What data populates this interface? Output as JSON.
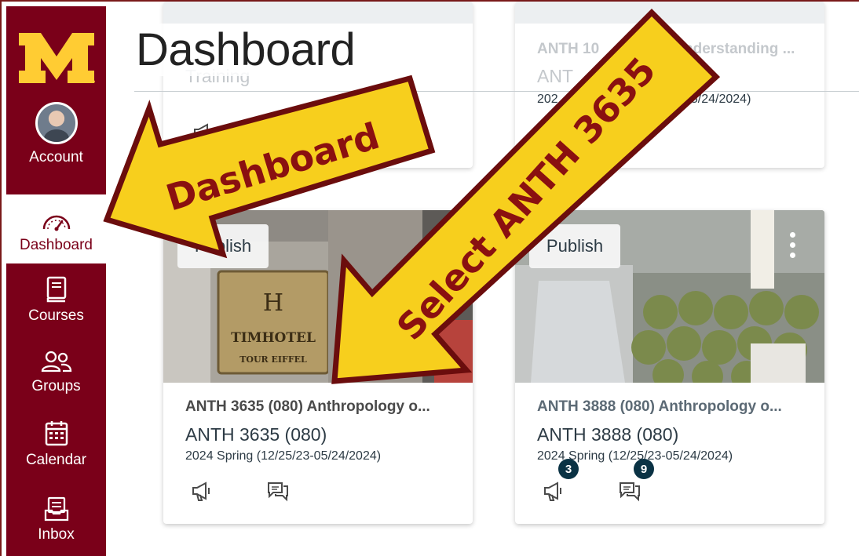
{
  "sidebar": {
    "items": [
      {
        "label": "Account",
        "icon": "avatar"
      },
      {
        "label": "Dashboard",
        "icon": "speedometer-icon"
      },
      {
        "label": "Courses",
        "icon": "book-icon"
      },
      {
        "label": "Groups",
        "icon": "people-icon"
      },
      {
        "label": "Calendar",
        "icon": "calendar-icon"
      },
      {
        "label": "Inbox",
        "icon": "inbox-icon"
      }
    ],
    "active": "Dashboard"
  },
  "header": {
    "title": "Dashboard"
  },
  "top_cards": [
    {
      "line1": "",
      "line2": "Training",
      "visible_text_right": "ANTH 10",
      "right_snippet": "nderstanding ...",
      "right_short": "ANT",
      "right_term": "202",
      "right_term_tail": "05/24/2024)"
    }
  ],
  "cards": [
    {
      "code": "ANTH 3635 (080) Anthropology o...",
      "short": "ANTH 3635 (080)",
      "term": "2024 Spring (12/25/23-05/24/2024)",
      "publish": "Publish",
      "image_sign_line1": "TIMHOTEL",
      "image_sign_line2": "TOUR EIFFEL",
      "announcements_badge": "",
      "discussions_badge": ""
    },
    {
      "code": "ANTH 3888 (080) Anthropology o...",
      "short": "ANTH 3888 (080)",
      "term": "2024 Spring (12/25/23-05/24/2024)",
      "publish": "Publish",
      "announcements_badge": "3",
      "discussions_badge": "9"
    }
  ],
  "annotations": {
    "arrow1": "Dashboard",
    "arrow2": "Select ANTH 3635"
  },
  "colors": {
    "brand": "#7a0019",
    "gold": "#ffcc33",
    "arrow_fill": "#f7cf1d",
    "arrow_stroke": "#6b0d0d",
    "badge": "#0a3244"
  }
}
